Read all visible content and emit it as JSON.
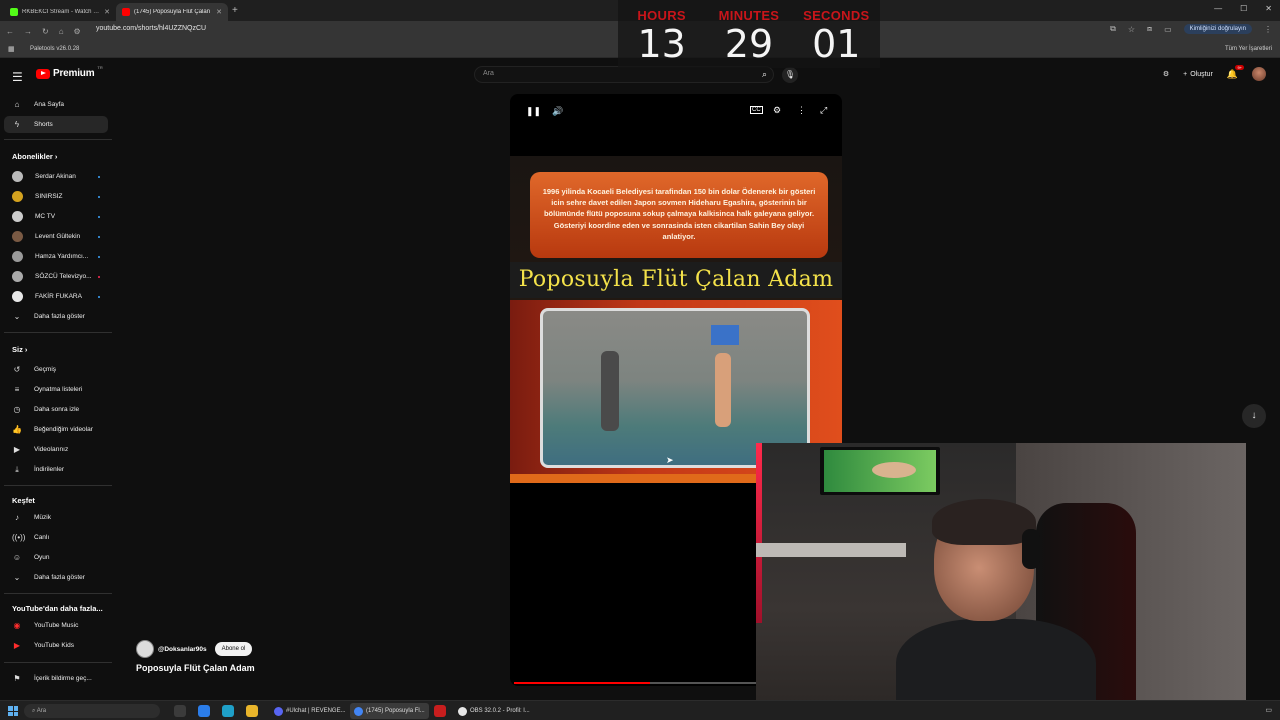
{
  "browser": {
    "tabs": [
      {
        "label": "RKBEKCİ Stream - Watch Live o",
        "active": false,
        "icon_color": "#53fc18"
      },
      {
        "label": "(1745) Poposuyla Flüt Çalan",
        "active": true,
        "icon_color": "#ff0000"
      }
    ],
    "url": "youtube.com/shorts/hl4UZZNQzCU",
    "verify_chip": "Kimliğinizi doğrulayın",
    "bookmark": "Paletools v26.0.28",
    "bookmarks_all": "Tüm Yer İşaretleri"
  },
  "countdown": {
    "hours_label": "HOURS",
    "minutes_label": "MINUTES",
    "seconds_label": "SECONDS",
    "hours": "13",
    "minutes": "29",
    "seconds": "01"
  },
  "header": {
    "logo_text": "Premium",
    "logo_region": "TR",
    "search_placeholder": "Ara",
    "create_label": "Oluştur",
    "notification_count": "9+"
  },
  "sidebar": {
    "main": [
      {
        "label": "Ana Sayfa",
        "icon": "home-icon"
      },
      {
        "label": "Shorts",
        "icon": "shorts-icon",
        "active": true
      }
    ],
    "subscriptions_heading": "Abonelikler",
    "subscriptions": [
      {
        "label": "Serdar Akinan",
        "color": "#bbbbbb"
      },
      {
        "label": "SINIRSIZ",
        "color": "#d4a21f"
      },
      {
        "label": "MC TV",
        "color": "#cccccc"
      },
      {
        "label": "Levent Gültekin",
        "color": "#7a5a44"
      },
      {
        "label": "Hamza Yardımcı...",
        "color": "#9a9a9a"
      },
      {
        "label": "SÖZCÜ Televizyo...",
        "color": "#aaaaaa"
      },
      {
        "label": "FAKİR FUKARA",
        "color": "#e8e8e8"
      }
    ],
    "show_more": "Daha fazla göster",
    "you_heading": "Siz",
    "you_items": [
      {
        "label": "Geçmiş",
        "icon": "history-icon"
      },
      {
        "label": "Oynatma listeleri",
        "icon": "playlists-icon"
      },
      {
        "label": "Daha sonra izle",
        "icon": "watch-later-icon"
      },
      {
        "label": "Beğendiğim videolar",
        "icon": "like-icon"
      },
      {
        "label": "Videolarınız",
        "icon": "your-videos-icon"
      },
      {
        "label": "İndirilenler",
        "icon": "download-icon"
      }
    ],
    "explore_heading": "Keşfet",
    "explore_items": [
      {
        "label": "Müzik",
        "icon": "music-icon"
      },
      {
        "label": "Canlı",
        "icon": "live-icon"
      },
      {
        "label": "Oyun",
        "icon": "gaming-icon"
      },
      {
        "label": "Daha fazla göster",
        "icon": "chevron-down-icon"
      }
    ],
    "more_heading": "YouTube'dan daha fazla...",
    "more_items": [
      {
        "label": "YouTube Music",
        "icon": "youtube-music-icon"
      },
      {
        "label": "YouTube Kids",
        "icon": "youtube-kids-icon"
      }
    ],
    "report_label": "İçerik bildirme geç..."
  },
  "video": {
    "caption": "1996 yilinda Kocaeli Belediyesi tarafindan 150 bin dolar Ödenerek bir gösteri icin sehre davet edilen Japon sovmen Hideharu Egashira, gösterinin bir bölümünde flütü poposuna sokup çalmaya kalkisinca halk galeyana geliyor. Gösteriyi koordine eden ve sonrasinda isten cikartilan Sahin Bey olayi anlatiyor.",
    "title_overlay": "Poposuyla Flüt Çalan Adam",
    "progress": 0.42
  },
  "channel": {
    "handle": "@Doksanlar90s",
    "subscribe_label": "Abone ol",
    "short_title": "Poposuyla Flüt Çalan Adam"
  },
  "taskbar": {
    "search_placeholder": "Ara",
    "apps": [
      {
        "label": "#Ulchat | REVENGE...",
        "active": false,
        "color": "#5865f2"
      },
      {
        "label": "(1745) Poposuyla Fl...",
        "active": true,
        "color": "#4285f4"
      },
      {
        "label": "OBS 32.0.2 - Profil: l...",
        "active": false,
        "color": "#e6e6e6"
      }
    ]
  }
}
